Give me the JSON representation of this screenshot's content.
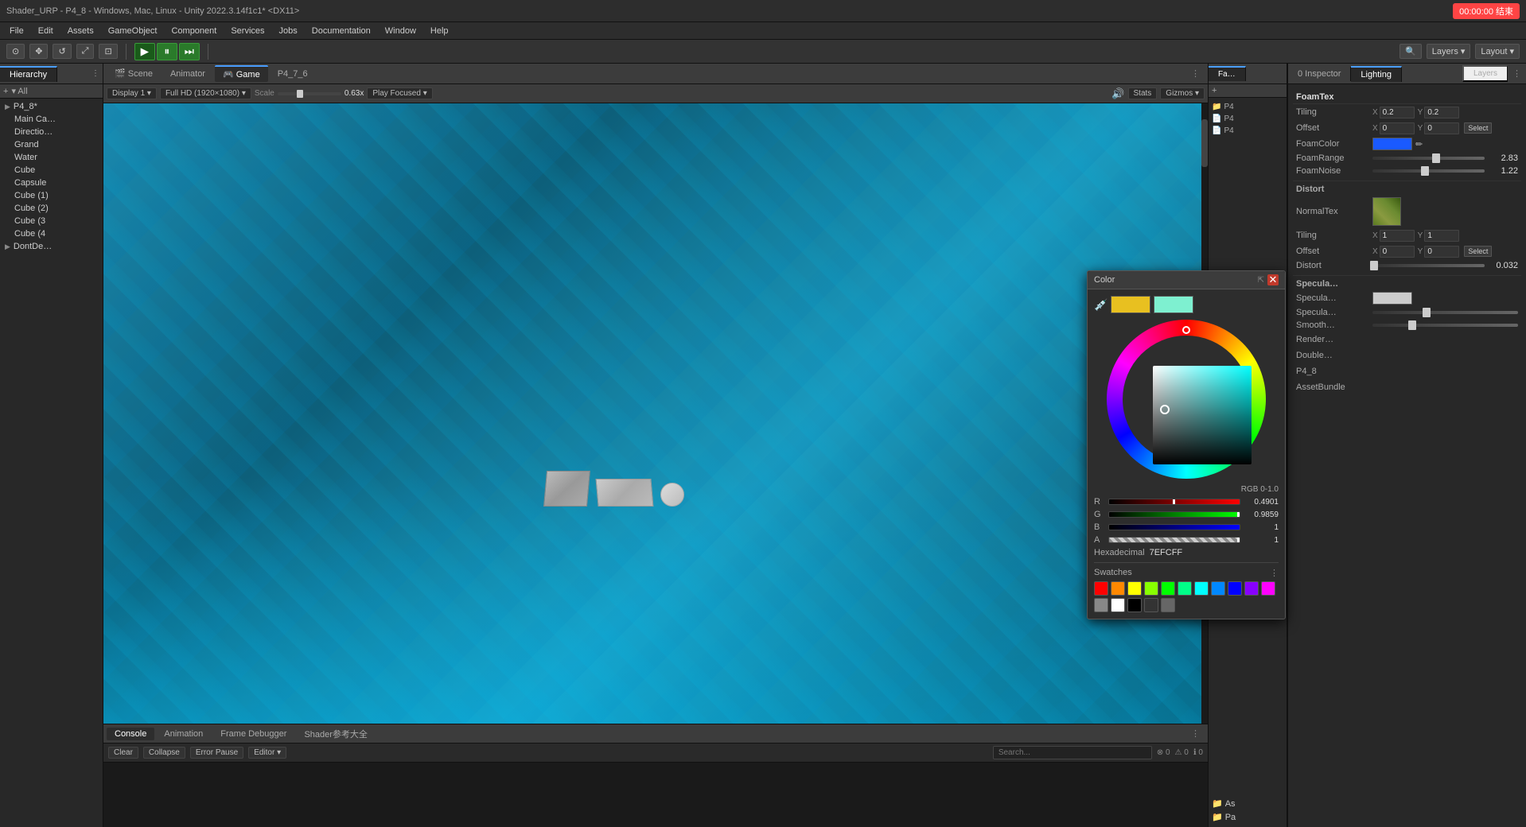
{
  "titlebar": {
    "title": "Shader_URP - P4_8 - Windows, Mac, Linux - Unity 2022.3.14f1c1* <DX11>",
    "record_label": "00:00:00 结束"
  },
  "menubar": {
    "items": [
      "File",
      "Edit",
      "Assets",
      "GameObject",
      "Component",
      "Services",
      "Jobs",
      "Documentation",
      "Window",
      "Help"
    ]
  },
  "toolbar": {
    "play_label": "▶",
    "pause_label": "⏸",
    "step_label": "⏭"
  },
  "hierarchy": {
    "title": "Hierarchy",
    "items": [
      {
        "label": "P4_8*",
        "indent": 1,
        "icon": "▶"
      },
      {
        "label": "Main Ca…",
        "indent": 2
      },
      {
        "label": "Directio…",
        "indent": 2
      },
      {
        "label": "Grand",
        "indent": 2
      },
      {
        "label": "Water",
        "indent": 2
      },
      {
        "label": "Cube",
        "indent": 2
      },
      {
        "label": "Capsule",
        "indent": 2
      },
      {
        "label": "Cube (1)",
        "indent": 2
      },
      {
        "label": "Cube (2)",
        "indent": 2
      },
      {
        "label": "Cube (3",
        "indent": 2
      },
      {
        "label": "Cube (4",
        "indent": 2
      },
      {
        "label": "DontDe…",
        "indent": 1,
        "icon": "▶"
      }
    ]
  },
  "view_tabs": {
    "tabs": [
      "Scene",
      "Animator",
      "Game",
      "P4_7_6"
    ]
  },
  "view_toolbar": {
    "display": "Display 1",
    "resolution": "Full HD (1920×1080)",
    "scale_label": "Scale",
    "scale_value": "0.63x",
    "play_focused": "Play Focused",
    "stats": "Stats",
    "gizmos": "Gizmos"
  },
  "inspector": {
    "tabs": [
      "Inspector",
      "Lighting"
    ],
    "title": "0 Inspector",
    "layers_label": "Layers",
    "foam_tex_label": "FoamTex",
    "tiling_label": "Tiling",
    "tiling_x": "0.2",
    "tiling_y": "0.2",
    "offset_label": "Offset",
    "offset_x": "0",
    "offset_y": "0",
    "select_label": "Select",
    "foam_color_label": "FoamColor",
    "foam_range_label": "FoamRange",
    "foam_range_val": "2.83",
    "foam_noise_label": "FoamNoise",
    "foam_noise_val": "1.22",
    "distort_label": "Distort",
    "normal_tex_label": "NormalTex",
    "distort_tiling_x": "1",
    "distort_tiling_y": "1",
    "distort_offset_x": "0",
    "distort_offset_y": "0",
    "distort_val": "0.032",
    "specular_label": "Specula…",
    "specular_color_label": "Specula…",
    "specular_val_label": "Specula…",
    "smooth_label": "Smooth…",
    "render_label": "Render…",
    "double_label": "Double…",
    "p4_8_label": "P4_8",
    "asset_bundle_label": "AssetBundle"
  },
  "color_picker": {
    "title": "Color",
    "rgb_mode": "RGB 0-1.0",
    "r_label": "R",
    "r_value": "0.4901",
    "g_label": "G",
    "g_value": "0.9859",
    "b_label": "B",
    "b_value": "1",
    "a_label": "A",
    "a_value": "1",
    "hex_label": "Hexadecimal",
    "hex_value": "7EFCFF",
    "swatches_label": "Swatches",
    "swatches": [
      "#ff0000",
      "#ff8800",
      "#ffff00",
      "#88ff00",
      "#00ff00",
      "#00ff88",
      "#00ffff",
      "#0088ff",
      "#0000ff",
      "#8800ff",
      "#ff00ff",
      "#888888",
      "#ffffff",
      "#000000",
      "#333333",
      "#666666"
    ]
  },
  "console": {
    "tabs": [
      "Console",
      "Animation",
      "Frame Debugger",
      "Shader参考大全"
    ],
    "clear_label": "Clear",
    "collapse_label": "Collapse",
    "error_pause_label": "Error Pause",
    "editor_label": "Editor",
    "error_count": "0",
    "warn_count": "0",
    "info_count": "0"
  }
}
